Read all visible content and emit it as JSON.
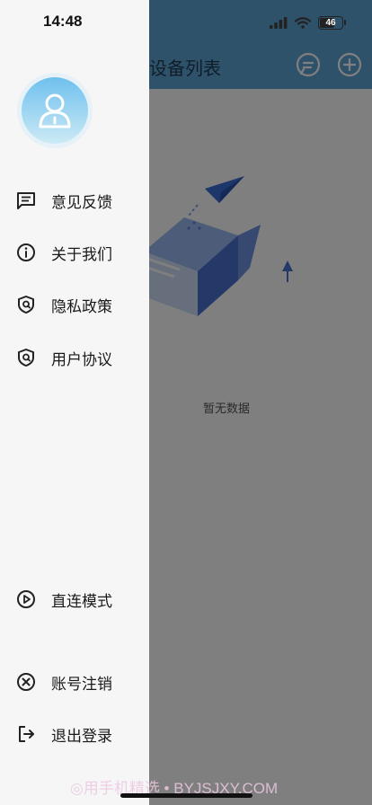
{
  "status_bar": {
    "time": "14:48",
    "battery": "46"
  },
  "background_page": {
    "title": "设备列表",
    "empty_text": "暂无数据",
    "header_icons": [
      "message-icon",
      "add-icon"
    ]
  },
  "drawer": {
    "menu": [
      {
        "label": "意见反馈",
        "icon": "feedback-icon"
      },
      {
        "label": "关于我们",
        "icon": "info-icon"
      },
      {
        "label": "隐私政策",
        "icon": "shield-icon"
      },
      {
        "label": "用户协议",
        "icon": "shield-icon"
      }
    ],
    "bottom_menu": [
      {
        "label": "直连模式",
        "icon": "play-circle-icon"
      },
      {
        "label": "账号注销",
        "icon": "close-circle-icon"
      },
      {
        "label": "退出登录",
        "icon": "logout-icon"
      }
    ]
  },
  "watermark": "◎用手机精选 • BYJSJXY.COM",
  "colors": {
    "header": "#5fa5d6",
    "drawer_bg": "#f6f6f7",
    "overlay": "rgba(0,0,0,0.5)"
  }
}
